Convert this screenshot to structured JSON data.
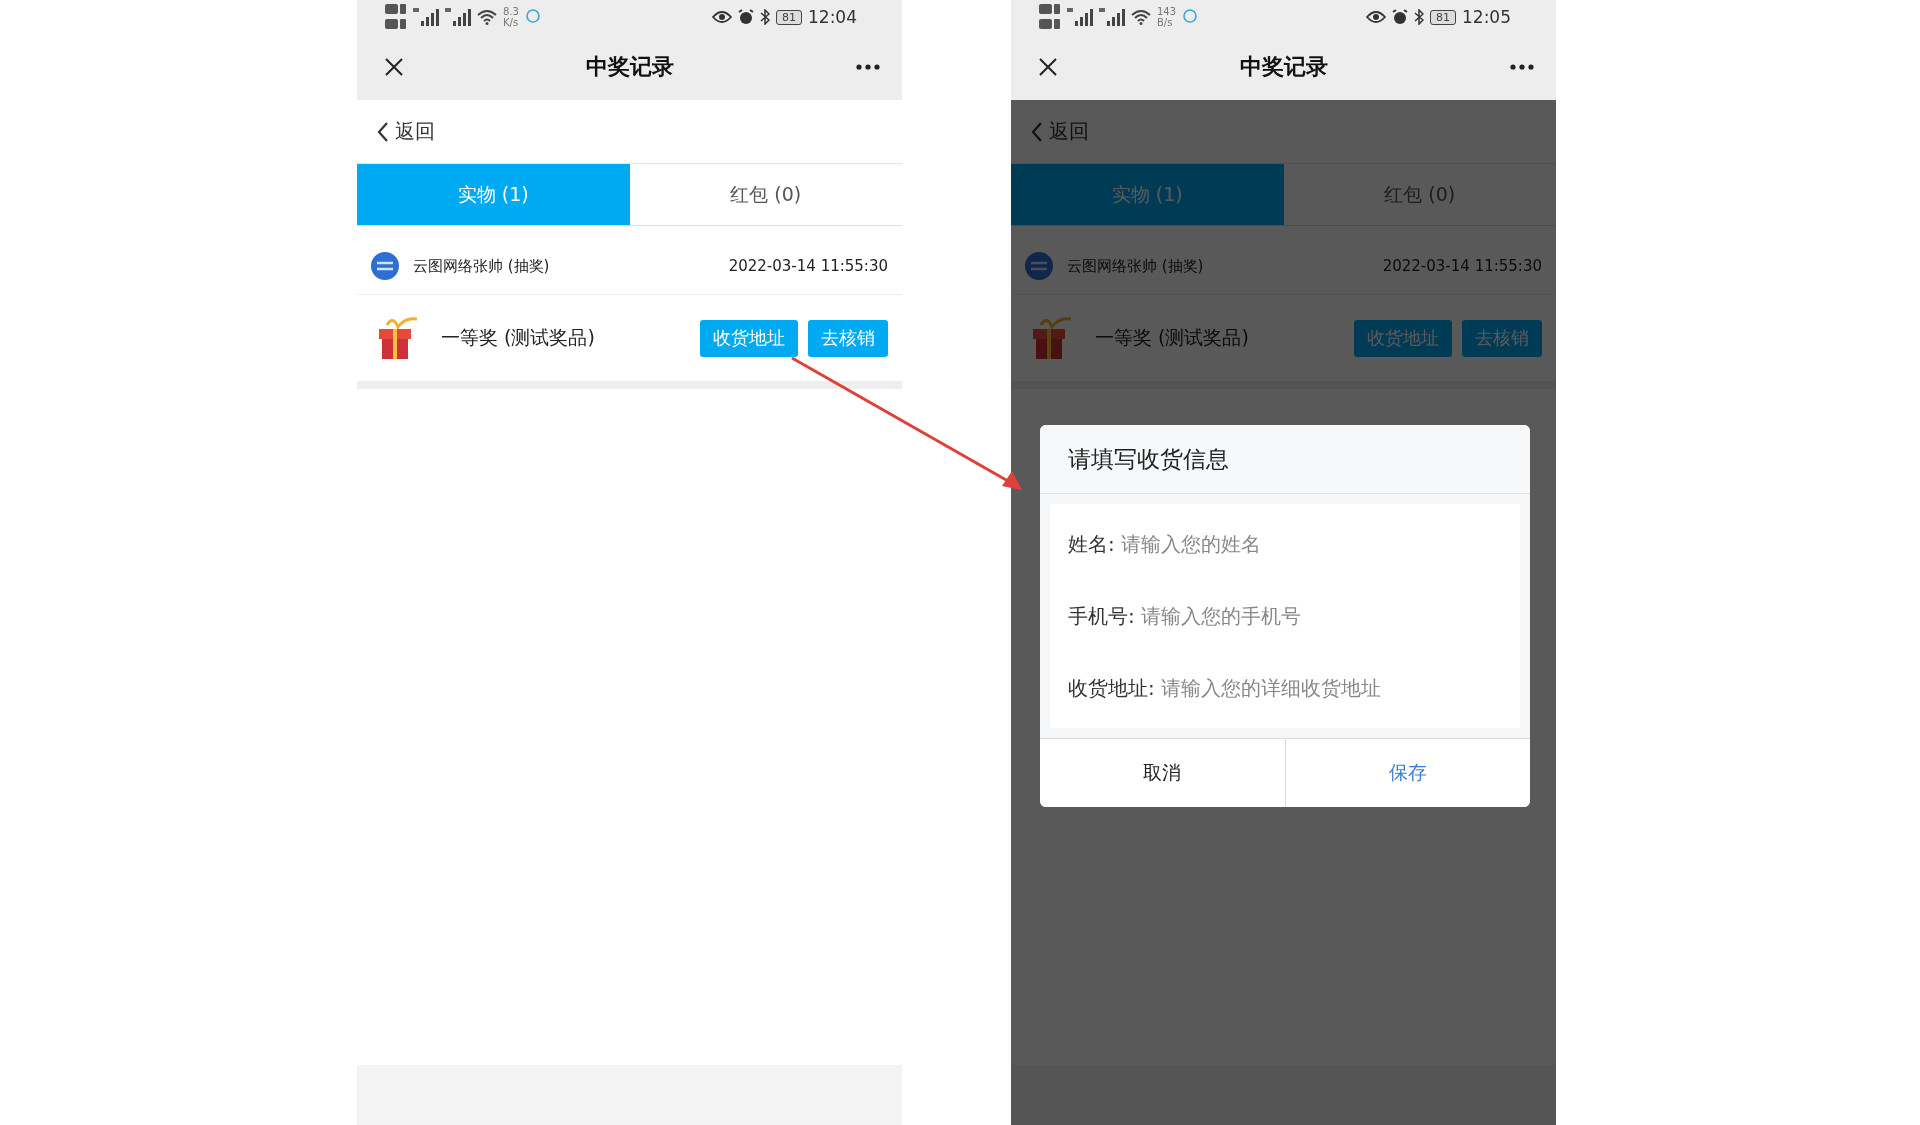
{
  "phones": [
    {
      "status_bar": {
        "speed": "8.3",
        "speed_unit": "K/s",
        "battery": "81",
        "time": "12:04"
      },
      "title": "中奖记录",
      "back": "返回",
      "tabs": [
        {
          "label": "实物 (1)",
          "selected": true
        },
        {
          "label": "红包 (0)",
          "selected": false
        }
      ],
      "records": [
        {
          "source": "云图网络张帅 (抽奖)",
          "time": "2022-03-14 11:55:30",
          "prize": "一等奖 (测试奖品)",
          "buttons": [
            "收货地址",
            "去核销"
          ]
        }
      ],
      "dimmed": false
    },
    {
      "status_bar": {
        "speed": "143",
        "speed_unit": "B/s",
        "battery": "81",
        "time": "12:05"
      },
      "title": "中奖记录",
      "back": "返回",
      "tabs": [
        {
          "label": "实物 (1)",
          "selected": true
        },
        {
          "label": "红包 (0)",
          "selected": false
        }
      ],
      "records": [
        {
          "source": "云图网络张帅 (抽奖)",
          "time": "2022-03-14 11:55:30",
          "prize": "一等奖 (测试奖品)",
          "buttons": [
            "收货地址",
            "去核销"
          ]
        }
      ],
      "dimmed": true,
      "dialog": {
        "title": "请填写收货信息",
        "fields": [
          {
            "label": "姓名:",
            "placeholder": "请输入您的姓名"
          },
          {
            "label": "手机号:",
            "placeholder": "请输入您的手机号"
          },
          {
            "label": "收货地址:",
            "placeholder": "请输入您的详细收货地址"
          }
        ],
        "buttons": [
          {
            "label": "取消",
            "kind": "cancel"
          },
          {
            "label": "保存",
            "kind": "confirm"
          }
        ]
      }
    }
  ]
}
